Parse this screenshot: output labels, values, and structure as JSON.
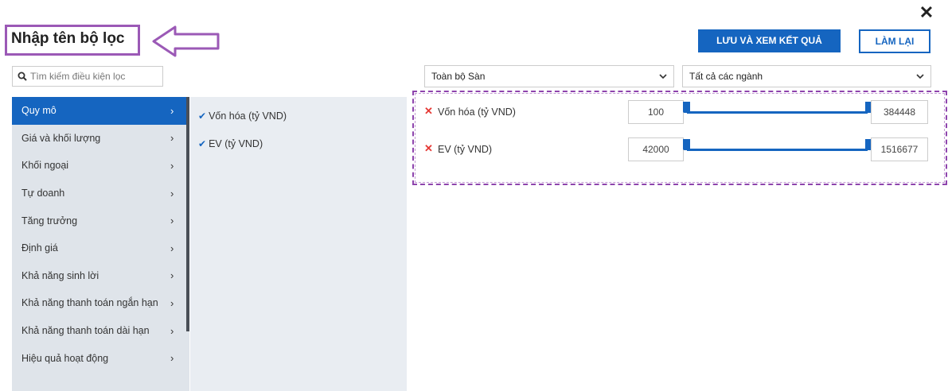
{
  "window": {
    "close_symbol": "✕"
  },
  "header": {
    "title": "Nhập tên bộ lọc",
    "save_button": "LƯU VÀ XEM KẾT QUẢ",
    "reset_button": "LÀM LẠI"
  },
  "search": {
    "placeholder": "Tìm kiếm điều kiện lọc",
    "value": ""
  },
  "selects": {
    "exchange": "Toàn bộ Sàn",
    "industry": "Tất cả các ngành"
  },
  "categories": [
    {
      "label": "Quy mô",
      "active": true
    },
    {
      "label": "Giá và khối lượng"
    },
    {
      "label": "Khối ngoại"
    },
    {
      "label": "Tự doanh"
    },
    {
      "label": "Tăng trưởng"
    },
    {
      "label": "Định giá"
    },
    {
      "label": "Khả năng sinh lời"
    },
    {
      "label": "Khả năng thanh toán ngắn hạn"
    },
    {
      "label": "Khả năng thanh toán dài hạn"
    },
    {
      "label": "Hiệu quả hoạt động"
    }
  ],
  "sub_items": [
    {
      "label": "Vốn hóa (tỷ VND)",
      "checked": true
    },
    {
      "label": "EV (tỷ VND)",
      "checked": true
    }
  ],
  "filters": [
    {
      "label": "Vốn hóa (tỷ VND)",
      "min": "100",
      "max": "384448",
      "range_min_fraction": 0.0,
      "range_max_fraction": 1.0
    },
    {
      "label": "EV (tỷ VND)",
      "min": "42000",
      "max": "1516677",
      "range_min_fraction": 0.0,
      "range_max_fraction": 1.0
    }
  ],
  "icons": {
    "search": "search-icon",
    "check": "check-icon",
    "remove": "remove-x-icon",
    "chevron_right": "chevron-right-icon",
    "chevron_down": "chevron-down-icon",
    "annotation_arrow": "annotation-arrow-icon"
  },
  "colors": {
    "primary": "#1565c0",
    "annotation": "#9b59b6",
    "remove": "#e53935",
    "sidebar_bg": "#dfe4ea"
  }
}
